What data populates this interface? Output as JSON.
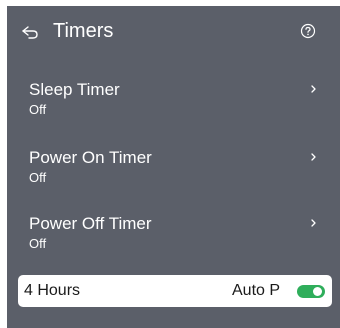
{
  "header": {
    "title": "Timers",
    "back_icon": "back-arrow-icon",
    "help_icon": "help-icon"
  },
  "timers": [
    {
      "label": "Sleep Timer",
      "value": "Off"
    },
    {
      "label": "Power On Timer",
      "value": "Off"
    },
    {
      "label": "Power Off Timer",
      "value": "Off"
    }
  ],
  "bottom_bar": {
    "hours_label": "4 Hours",
    "auto_label": "Auto P",
    "toggle_on": true
  },
  "colors": {
    "panel_background": "#5b5f69",
    "toggle_on": "#2fae5b",
    "bar_background": "#ffffff"
  }
}
